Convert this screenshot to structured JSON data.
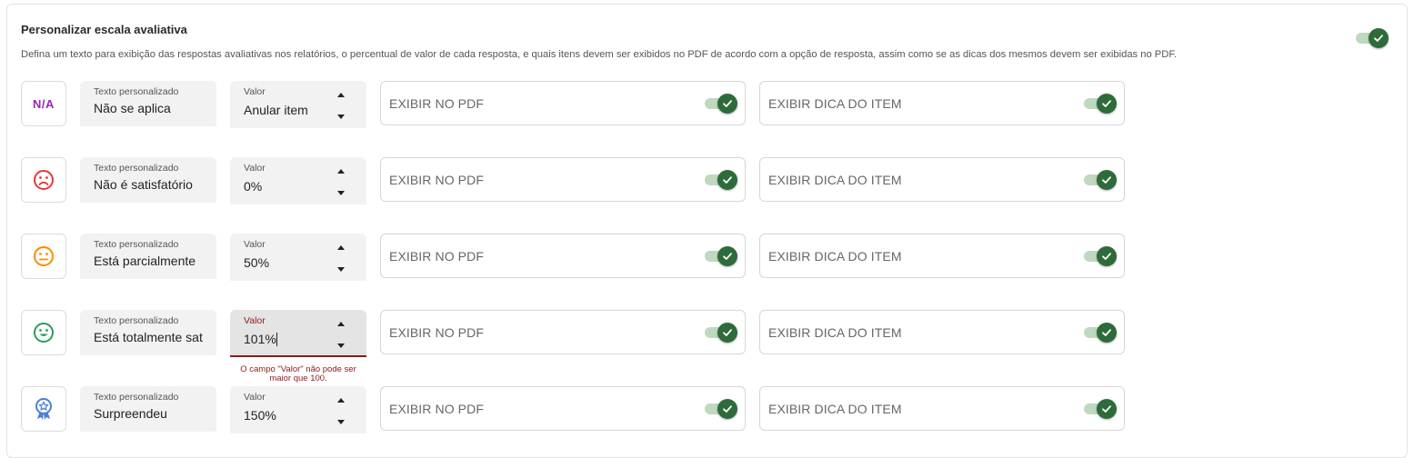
{
  "section": {
    "title": "Personalizar escala avaliativa",
    "description": "Defina um texto para exibição das respostas avaliativas nos relatórios, o percentual de valor de cada resposta, e quais itens devem ser exibidos no PDF de acordo com a opção de resposta, assim como se as dicas dos mesmos devem ser exibidas no PDF.",
    "enabled": true
  },
  "labels": {
    "text_field": "Texto personalizado",
    "value_field": "Valor",
    "show_pdf": "EXIBIR NO PDF",
    "show_hint": "EXIBIR DICA DO ITEM"
  },
  "colors": {
    "toggle_on": "#2e6b3a",
    "toggle_track": "#bfd8bf",
    "error": "#8b1a1a",
    "na_icon": "#9c27b0",
    "sad_icon": "#e53935",
    "neutral_icon": "#fb8c00",
    "happy_icon": "#2e9a5a",
    "badge_icon": "#4a7fd4"
  },
  "rows": [
    {
      "icon": "na-icon",
      "icon_text": "N/A",
      "text": "Não se aplica",
      "value": "Anular item",
      "show_pdf": true,
      "show_hint": true
    },
    {
      "icon": "sad-face-icon",
      "text": "Não é satisfatório",
      "value": "0%",
      "show_pdf": true,
      "show_hint": true
    },
    {
      "icon": "neutral-face-icon",
      "text": "Está parcialmente",
      "value": "50%",
      "show_pdf": true,
      "show_hint": true
    },
    {
      "icon": "happy-face-icon",
      "text": "Está totalmente satisfatório",
      "value": "101%",
      "error": "O campo \"Valor\" não pode ser maior que 100.",
      "show_pdf": true,
      "show_hint": true
    },
    {
      "icon": "star-badge-icon",
      "text": "Surpreendeu",
      "value": "150%",
      "show_pdf": true,
      "show_hint": true
    }
  ]
}
